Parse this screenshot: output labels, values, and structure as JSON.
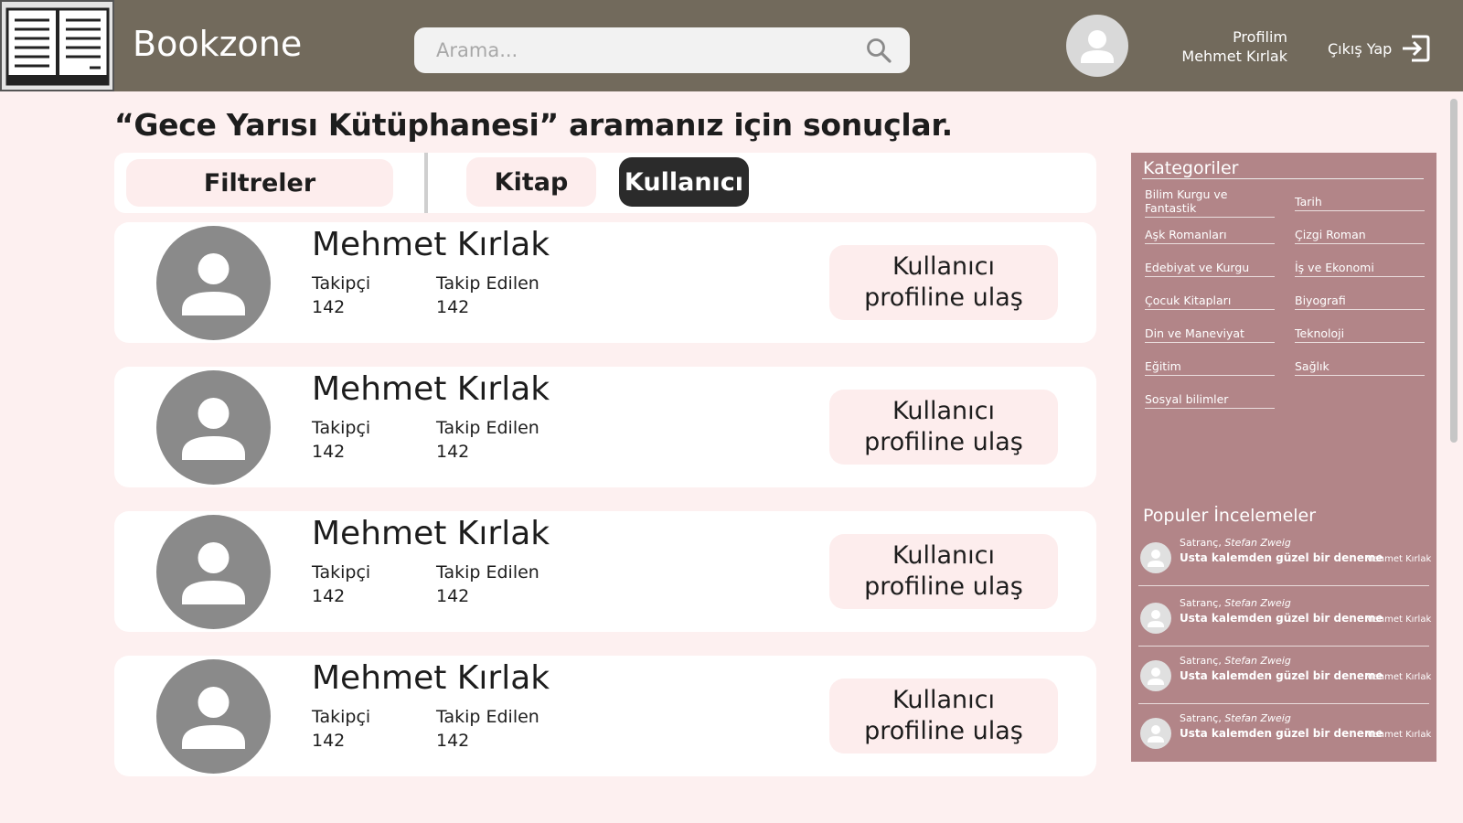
{
  "header": {
    "brand": "Bookzone",
    "search_placeholder": "Arama...",
    "profile_label": "Profilim",
    "profile_name": "Mehmet Kırlak",
    "logout_label": "Çıkış Yap"
  },
  "page": {
    "title": "“Gece Yarısı Kütüphanesi”  aramanız için sonuçlar."
  },
  "tabs": {
    "filters": "Filtreler",
    "book": "Kitap",
    "user": "Kullanıcı",
    "active": "user"
  },
  "results": [
    {
      "name": "Mehmet Kırlak",
      "followers_label": "Takipçi",
      "followers": "142",
      "following_label": "Takip Edilen",
      "following": "142",
      "button": "Kullanıcı\nprofiline ulaş"
    },
    {
      "name": "Mehmet Kırlak",
      "followers_label": "Takipçi",
      "followers": "142",
      "following_label": "Takip Edilen",
      "following": "142",
      "button": "Kullanıcı\nprofiline ulaş"
    },
    {
      "name": "Mehmet Kırlak",
      "followers_label": "Takipçi",
      "followers": "142",
      "following_label": "Takip Edilen",
      "following": "142",
      "button": "Kullanıcı\nprofiline ulaş"
    },
    {
      "name": "Mehmet Kırlak",
      "followers_label": "Takipçi",
      "followers": "142",
      "following_label": "Takip Edilen",
      "following": "142",
      "button": "Kullanıcı\nprofiline ulaş"
    }
  ],
  "sidebar": {
    "categories_title": "Kategoriler",
    "categories": [
      "Bilim Kurgu ve Fantastik",
      "Tarih",
      "Aşk Romanları",
      "Çizgi Roman",
      "Edebiyat ve Kurgu",
      "İş ve Ekonomi",
      "Çocuk Kitapları",
      "Biyografi",
      "Din ve Maneviyat",
      "Teknoloji",
      "Eğitim",
      "Sağlık",
      "Sosyal bilimler"
    ],
    "reviews_title": "Populer İncelemeler",
    "reviews": [
      {
        "book": "Satranç,",
        "author": "Stefan Zweig",
        "text": "Usta kalemden güzel bir deneme",
        "user": "Mehmet Kırlak"
      },
      {
        "book": "Satranç,",
        "author": "Stefan Zweig",
        "text": "Usta kalemden güzel bir deneme",
        "user": "Mehmet Kırlak"
      },
      {
        "book": "Satranç,",
        "author": "Stefan Zweig",
        "text": "Usta kalemden güzel bir deneme",
        "user": "Mehmet Kırlak"
      },
      {
        "book": "Satranç,",
        "author": "Stefan Zweig",
        "text": "Usta kalemden güzel bir deneme",
        "user": "Mehmet Kırlak"
      }
    ]
  },
  "colors": {
    "header_bg": "#726a5c",
    "page_bg": "#fdf0f0",
    "sidebar_bg": "#b28588",
    "active_tab": "#2b2b2b",
    "pill_bg": "#fdeded"
  },
  "icons": {
    "logo": "open-book-icon",
    "search": "search-icon",
    "avatar": "user-icon",
    "logout": "logout-icon"
  }
}
